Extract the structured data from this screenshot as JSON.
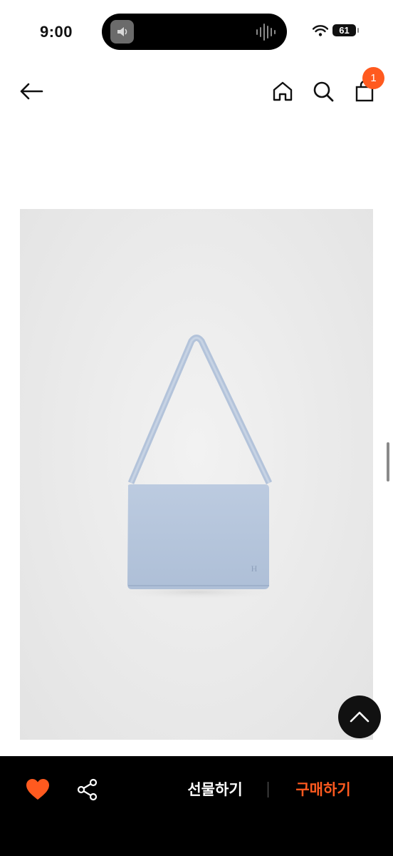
{
  "status_bar": {
    "time": "9:00",
    "battery": "61"
  },
  "header": {
    "cart_count": "1"
  },
  "icons": {
    "back": "arrow-left-icon",
    "home": "home-icon",
    "search": "search-icon",
    "cart": "shopping-bag-icon",
    "scroll_top": "chevron-up-icon",
    "like": "heart-icon",
    "share": "share-icon"
  },
  "colors": {
    "accent": "#ff5a1f",
    "bottom_bar": "#000000",
    "bag": "#b9c9df"
  },
  "bottom_bar": {
    "gift_label": "선물하기",
    "buy_label": "구매하기"
  }
}
